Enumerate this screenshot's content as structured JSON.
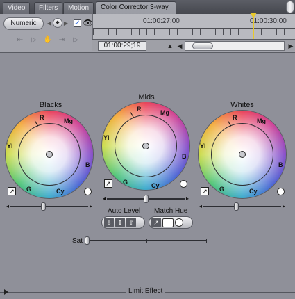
{
  "tabs": [
    {
      "label": "Video"
    },
    {
      "label": "Filters"
    },
    {
      "label": "Motion"
    },
    {
      "label": "Color Corrector 3-way",
      "active": true
    }
  ],
  "toolbar": {
    "numeric_label": "Numeric",
    "visible_checked": true
  },
  "timeline": {
    "timecode_mid": "01:00:27;00",
    "timecode_right": "01:00:30;00",
    "current_timecode": "01:00:29;19"
  },
  "wheels": [
    {
      "title": "Blacks",
      "labels": {
        "r": "R",
        "mg": "Mg",
        "b": "B",
        "cy": "Cy",
        "g": "G",
        "yl": "Yl"
      },
      "balance_level": 0.42
    },
    {
      "title": "Mids",
      "labels": {
        "r": "R",
        "mg": "Mg",
        "b": "B",
        "cy": "Cy",
        "g": "G",
        "yl": "Yl"
      },
      "balance_level": 0.5
    },
    {
      "title": "Whites",
      "labels": {
        "r": "R",
        "mg": "Mg",
        "b": "B",
        "cy": "Cy",
        "g": "G",
        "yl": "Yl"
      },
      "balance_level": 0.42
    }
  ],
  "auto_level": {
    "label": "Auto Level"
  },
  "match_hue": {
    "label": "Match Hue"
  },
  "sat": {
    "label": "Sat",
    "level": 0.0
  },
  "limit_effect": {
    "label": "Limit Effect"
  },
  "colors": {
    "panel_bg": "#8f9099",
    "playhead": "#e8c92a",
    "check_accent": "#1d5bd8"
  },
  "icons": [
    "close-icon",
    "eye-icon",
    "eyedropper-icon",
    "keyframe-icon",
    "play-icon"
  ]
}
